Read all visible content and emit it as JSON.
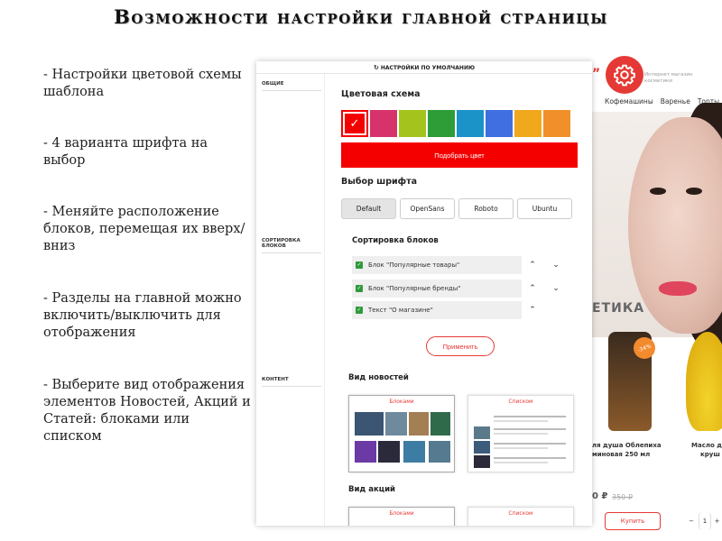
{
  "slide": {
    "title": "Возможности настройки главной страницы",
    "bullets": [
      "- Настройки цветовой схемы шаблона",
      "- 4 варианта шрифта на выбор",
      "- Меняйте расположение блоков, перемещая их вверх/вниз",
      "- Разделы на главной можно включить/выключить для отображения",
      "- Выберите вид отображения элементов Новостей, Акций и Статей: блоками или списком"
    ]
  },
  "panel": {
    "reset_label": "НАСТРОЙКИ ПО УМОЛЧАНИЮ",
    "sidebar": [
      "ОБЩИЕ",
      "СОРТИРОВКА БЛОКОВ",
      "КОНТЕНТ"
    ],
    "color_scheme": {
      "title": "Цветовая схема",
      "colors": [
        "#f50000",
        "#d6336c",
        "#a4c41d",
        "#2f9d37",
        "#1b93c8",
        "#3f6fe0",
        "#f0a81c",
        "#f1902a"
      ],
      "selected_index": 0,
      "pick_button": "Подобрать цвет",
      "pick_button_color": "#f50000"
    },
    "font_choice": {
      "title": "Выбор шрифта",
      "options": [
        "Default",
        "OpenSans",
        "Roboto",
        "Ubuntu"
      ],
      "selected": "Default"
    },
    "block_sort": {
      "title": "Сортировка блоков",
      "blocks": [
        "Блок \"Популярные товары\"",
        "Блок \"Популярные бренды\"",
        "Текст \"О магазине\""
      ],
      "apply_button": "Применить"
    },
    "news_view": {
      "title": "Вид новостей",
      "options": [
        "Блоками",
        "Списком"
      ],
      "selected": "Блоками"
    },
    "promo_view": {
      "title": "Вид акций",
      "options": [
        "Блоками",
        "Списком"
      ],
      "selected": "Блоками"
    },
    "accent_color": "#e53935"
  },
  "store": {
    "tagline": "Интернет магазин косметики",
    "nav": [
      "Кофемашины",
      "Варенье",
      "Торты"
    ],
    "heading": "ЕТИКА",
    "badge": "-34%",
    "products": [
      {
        "name": "ля душа Облепиха",
        "sub": "миновая 250 мл",
        "price": "0 ₽",
        "old_price": "350 ₽"
      },
      {
        "name": "Масло д",
        "sub": "круш",
        "price": "",
        "old_price": ""
      }
    ],
    "buy_label": "Купить",
    "qty": {
      "minus": "−",
      "value": "1",
      "plus": "+"
    }
  }
}
